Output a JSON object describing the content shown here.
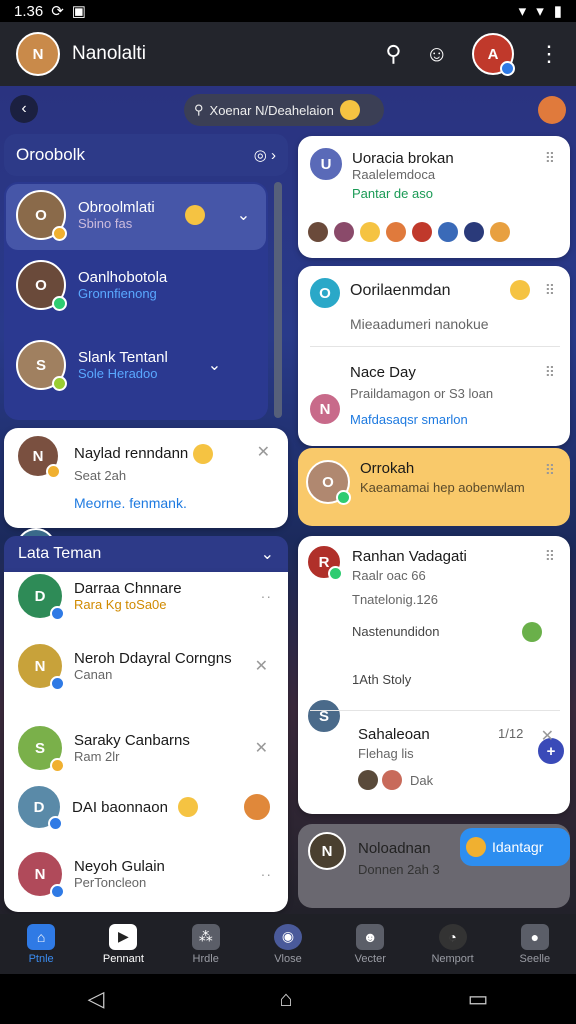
{
  "status": {
    "time": "1.36"
  },
  "topbar": {
    "title": "Nanolalti"
  },
  "search": {
    "placeholder": "Xoenar N/Deahelaion"
  },
  "leftpanel": {
    "header": "Oroobolk",
    "items": [
      {
        "name": "Obroolmlati",
        "sub": "Sbino fas"
      },
      {
        "name": "Oanlhobotola",
        "sub": "Gronnfienong"
      },
      {
        "name": "Slank Tentanl",
        "sub": "Sole Heradoo"
      }
    ]
  },
  "notif": {
    "name": "Naylad renndann",
    "sub": "Seat 2ah",
    "link": "Meorne. fenmank."
  },
  "friends": {
    "header": "Lata Teman",
    "items": [
      {
        "name": "Darraa Chnnare",
        "sub": "Rara Kg toSa0e"
      },
      {
        "name": "Neroh Ddayral Corngns",
        "sub": "Canan"
      },
      {
        "name": "Saraky Canbarns",
        "sub": "Ram 2lr"
      },
      {
        "name": "DAI baonnaon",
        "sub": ""
      },
      {
        "name": "Neyoh Gulain",
        "sub": "PerToncleon"
      }
    ]
  },
  "right": {
    "c1": {
      "name": "Uoracia brokan",
      "sub": "Raalelemdoca",
      "meta": "Pantar de aso"
    },
    "c2": {
      "name": "Oorilaenmdan",
      "sub": "Mieaadumeri nanokue"
    },
    "c3": {
      "name": "Nace Day",
      "sub": "Praildamagon or S3 loan",
      "meta": "Mafdasaqsr smarlon"
    },
    "c4": {
      "name": "Orrokah",
      "sub": "Kaeamamai hep aobenwlam"
    },
    "c5": {
      "name": "Ranhan Vadagati",
      "sub": "Raalr oac 66",
      "meta": "Tnatelonig.126",
      "meta2": "Nastenundidon",
      "story": "1Ath Stoly",
      "name2": "Sahaleoan",
      "sub2": "Flehag lis",
      "tag": "Dak",
      "ratio": "1/12"
    },
    "c6": {
      "name": "Noloadnan",
      "sub": "Donnen 2ah 3",
      "button": "Idantagr"
    }
  },
  "nav": [
    "Ptnle",
    "Pennant",
    "Hrdle",
    "Vlose",
    "Vecter",
    "Nemport",
    "Seelle"
  ],
  "colors": {
    "accent": "#2f7ae5",
    "panel": "#2b3990",
    "highlight": "#f9c96a"
  }
}
